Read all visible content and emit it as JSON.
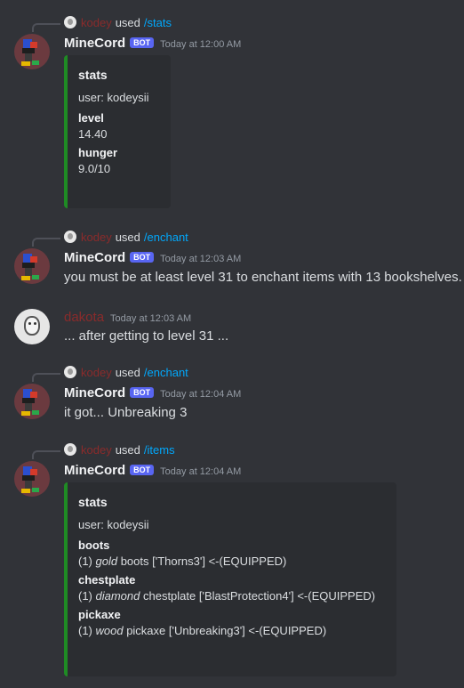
{
  "messages": [
    {
      "reply": {
        "user": "kodey",
        "used": "used",
        "command": "/stats"
      },
      "author": "MineCord",
      "bot_tag": "BOT",
      "timestamp": "Today at 12:00 AM",
      "embed": {
        "title": "stats",
        "description": "user: kodeysii",
        "fields": [
          {
            "name": "level",
            "value": "14.40"
          },
          {
            "name": "hunger",
            "value": "9.0/10"
          }
        ]
      }
    },
    {
      "reply": {
        "user": "kodey",
        "used": "used",
        "command": "/enchant"
      },
      "author": "MineCord",
      "bot_tag": "BOT",
      "timestamp": "Today at 12:03 AM",
      "text": "you must be at least level 31 to enchant items with 13 bookshelves."
    },
    {
      "author": "dakota",
      "timestamp": "Today at 12:03 AM",
      "text": "... after getting to level 31 ..."
    },
    {
      "reply": {
        "user": "kodey",
        "used": "used",
        "command": "/enchant"
      },
      "author": "MineCord",
      "bot_tag": "BOT",
      "timestamp": "Today at 12:04 AM",
      "text": "it got... Unbreaking 3"
    },
    {
      "reply": {
        "user": "kodey",
        "used": "used",
        "command": "/items"
      },
      "author": "MineCord",
      "bot_tag": "BOT",
      "timestamp": "Today at 12:04 AM",
      "embed": {
        "title": "stats",
        "description": "user: kodeysii",
        "fields": [
          {
            "name": "boots",
            "prefix": "(1) ",
            "material": "gold",
            "value": " boots ['Thorns3'] <-(EQUIPPED)"
          },
          {
            "name": "chestplate",
            "prefix": "(1) ",
            "material": "diamond",
            "value": " chestplate ['BlastProtection4'] <-(EQUIPPED)"
          },
          {
            "name": "pickaxe",
            "prefix": "(1) ",
            "material": "wood",
            "value": " pickaxe ['Unbreaking3'] <-(EQUIPPED)"
          }
        ]
      }
    }
  ],
  "colors": {
    "background": "#313338",
    "embed_bg": "#2b2d31",
    "embed_border": "#1f8b24",
    "bot_tag": "#5865f2",
    "command": "#00a8fc"
  }
}
